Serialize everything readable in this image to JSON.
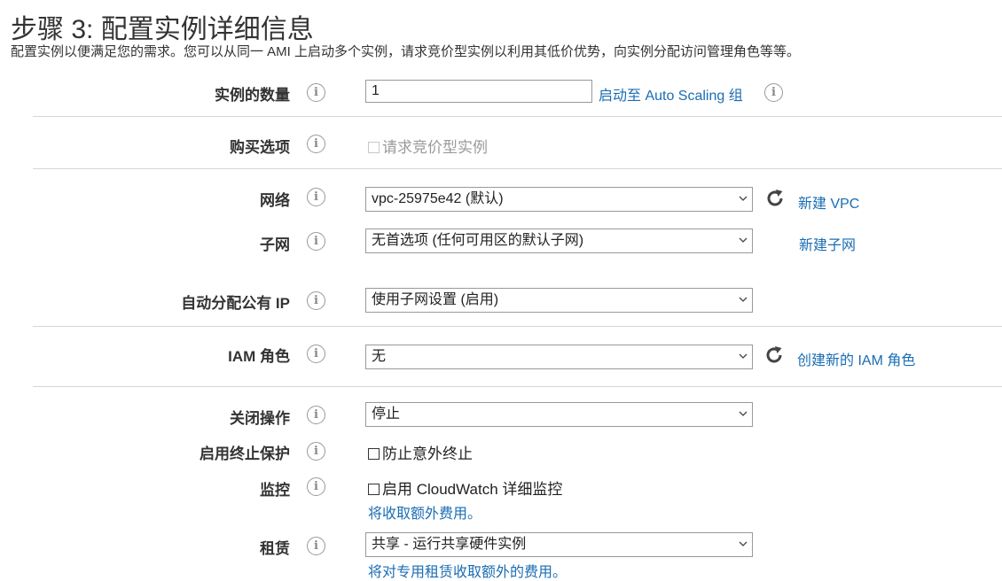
{
  "header": {
    "title": "步骤 3: 配置实例详细信息",
    "subtitle": "配置实例以便满足您的需求。您可以从同一 AMI 上启动多个实例，请求竞价型实例以利用其低价优势，向实例分配访问管理角色等等。"
  },
  "instances": {
    "label": "实例的数量",
    "value": "1",
    "asg_link": "启动至 Auto Scaling 组"
  },
  "purchase": {
    "label": "购买选项",
    "checkbox_label": "请求竞价型实例"
  },
  "network": {
    "label": "网络",
    "selected": "vpc-25975e42 (默认)",
    "link": "新建 VPC"
  },
  "subnet": {
    "label": "子网",
    "selected": "无首选项 (任何可用区的默认子网)",
    "link": "新建子网"
  },
  "public_ip": {
    "label": "自动分配公有 IP",
    "selected": "使用子网设置 (启用)"
  },
  "iam": {
    "label": "IAM 角色",
    "selected": "无",
    "link": "创建新的 IAM 角色"
  },
  "shutdown": {
    "label": "关闭操作",
    "selected": "停止"
  },
  "termination": {
    "label": "启用终止保护",
    "checkbox_label": "防止意外终止"
  },
  "monitoring": {
    "label": "监控",
    "checkbox_label": "启用 CloudWatch 详细监控",
    "note": "将收取额外费用。"
  },
  "tenancy": {
    "label": "租赁",
    "selected": "共享 - 运行共享硬件实例",
    "note": "将对专用租赁收取额外的费用。"
  },
  "icons": {
    "info": "i"
  },
  "colors": {
    "link": "#1a6db3",
    "divider": "#d6d6d6",
    "border": "#999999"
  }
}
